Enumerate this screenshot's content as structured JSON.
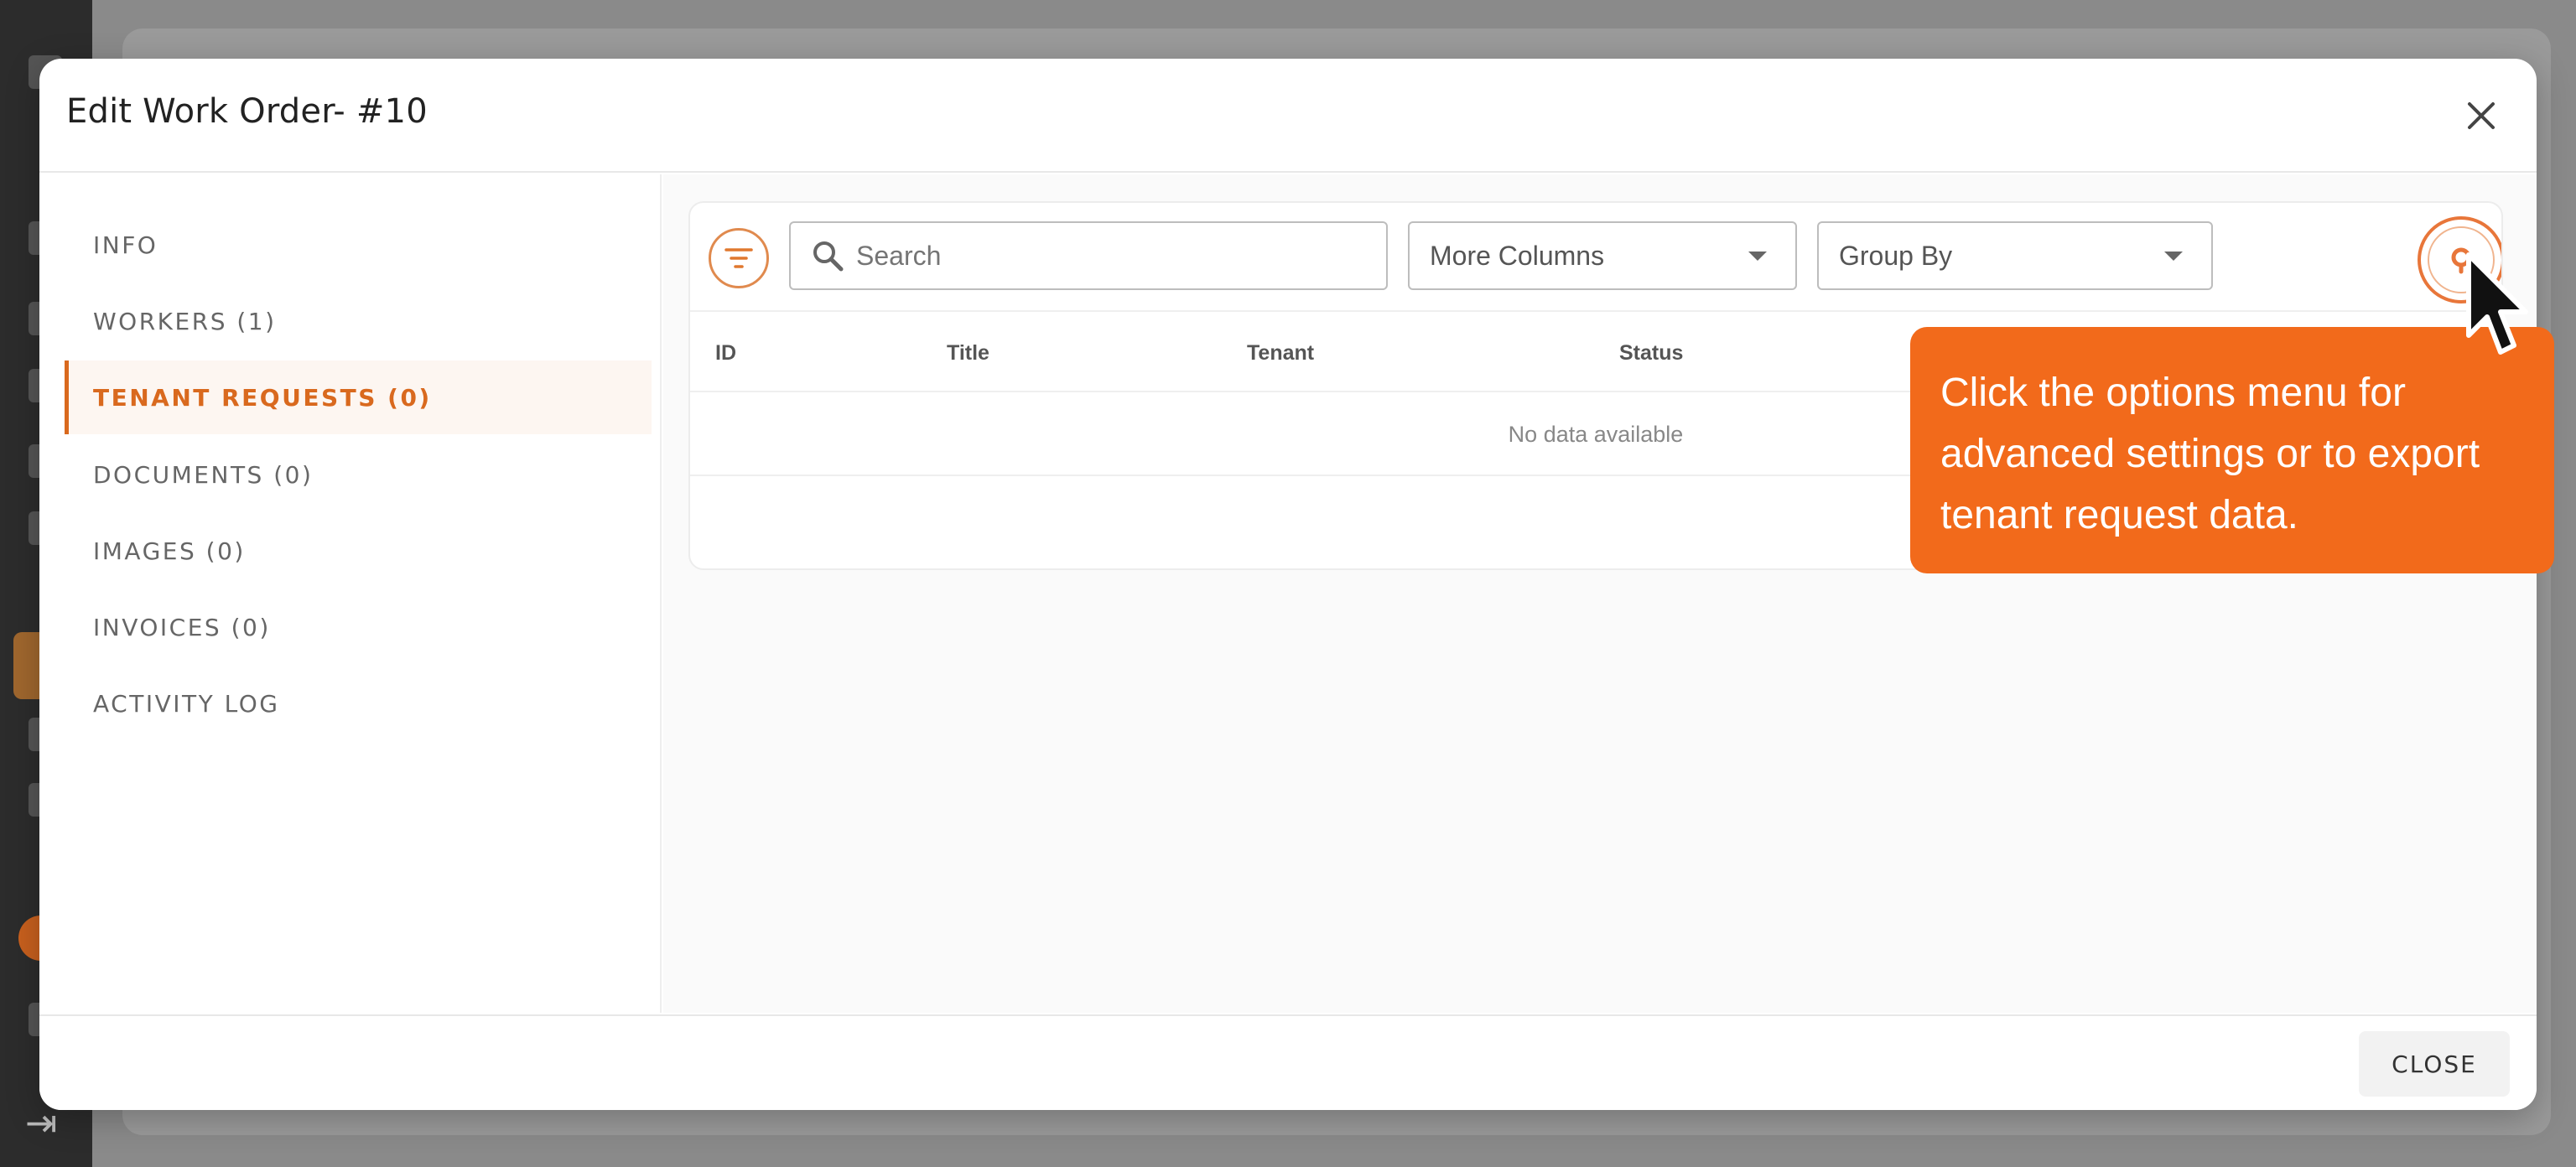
{
  "modal": {
    "title": "Edit Work Order- #10",
    "close_label": "CLOSE"
  },
  "nav": {
    "items": [
      {
        "label": "INFO",
        "active": false
      },
      {
        "label": "WORKERS (1)",
        "active": false
      },
      {
        "label": "TENANT REQUESTS (0)",
        "active": true
      },
      {
        "label": "DOCUMENTS (0)",
        "active": false
      },
      {
        "label": "IMAGES (0)",
        "active": false
      },
      {
        "label": "INVOICES (0)",
        "active": false
      },
      {
        "label": "ACTIVITY LOG",
        "active": false
      }
    ]
  },
  "toolbar": {
    "search_placeholder": "Search",
    "more_columns": "More Columns",
    "group_by": "Group By"
  },
  "table": {
    "columns": [
      "ID",
      "Title",
      "Tenant",
      "Status"
    ],
    "empty_text": "No data available"
  },
  "tooltip": {
    "text": "Click the options menu for advanced settings or to export tenant request data."
  },
  "colors": {
    "accent": "#d9691e",
    "tooltip_bg": "#f26a1b"
  },
  "icons": {
    "filter": "filter-icon",
    "search": "search-icon",
    "options": "options-icon",
    "close": "close-icon"
  }
}
